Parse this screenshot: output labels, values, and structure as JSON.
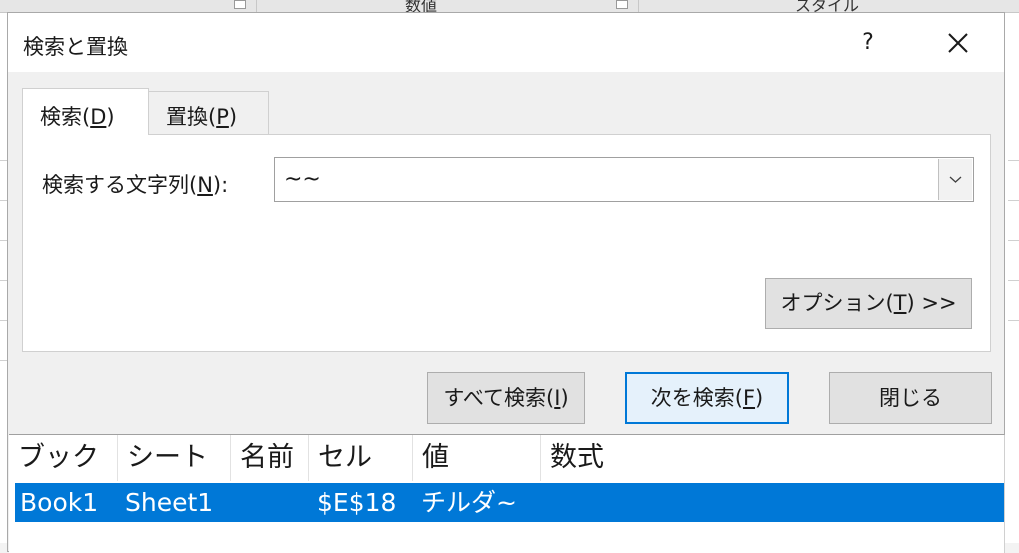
{
  "dialog": {
    "title": "検索と置換",
    "help_label": "?",
    "tabs": [
      {
        "label_pre": "検索(",
        "label_key": "D",
        "label_post": ")"
      },
      {
        "label_pre": "置換(",
        "label_key": "P",
        "label_post": ")"
      }
    ],
    "find": {
      "label_pre": "検索する文字列(",
      "label_key": "N",
      "label_post": "):",
      "value": "~~"
    },
    "options_button": {
      "pre": "オプション(",
      "key": "T",
      "post": ") >>"
    },
    "find_all_button": {
      "pre": "すべて検索(",
      "key": "I",
      "post": ")"
    },
    "find_next_button": {
      "pre": "次を検索(",
      "key": "F",
      "post": ")"
    },
    "close_button": "閉じる"
  },
  "results": {
    "columns": [
      "ブック",
      "シート",
      "名前",
      "セル",
      "値",
      "数式"
    ],
    "rows": [
      {
        "book": "Book1",
        "sheet": "Sheet1",
        "name": "",
        "cell": "$E$18",
        "value": "チルダ~",
        "formula": ""
      }
    ]
  },
  "background_sheet": {
    "header_texts": [
      "数値",
      "スタイル"
    ]
  },
  "colors": {
    "selection": "#0078d7",
    "dialog_bg": "#f0f0f0",
    "default_button_border": "#0078d7"
  }
}
